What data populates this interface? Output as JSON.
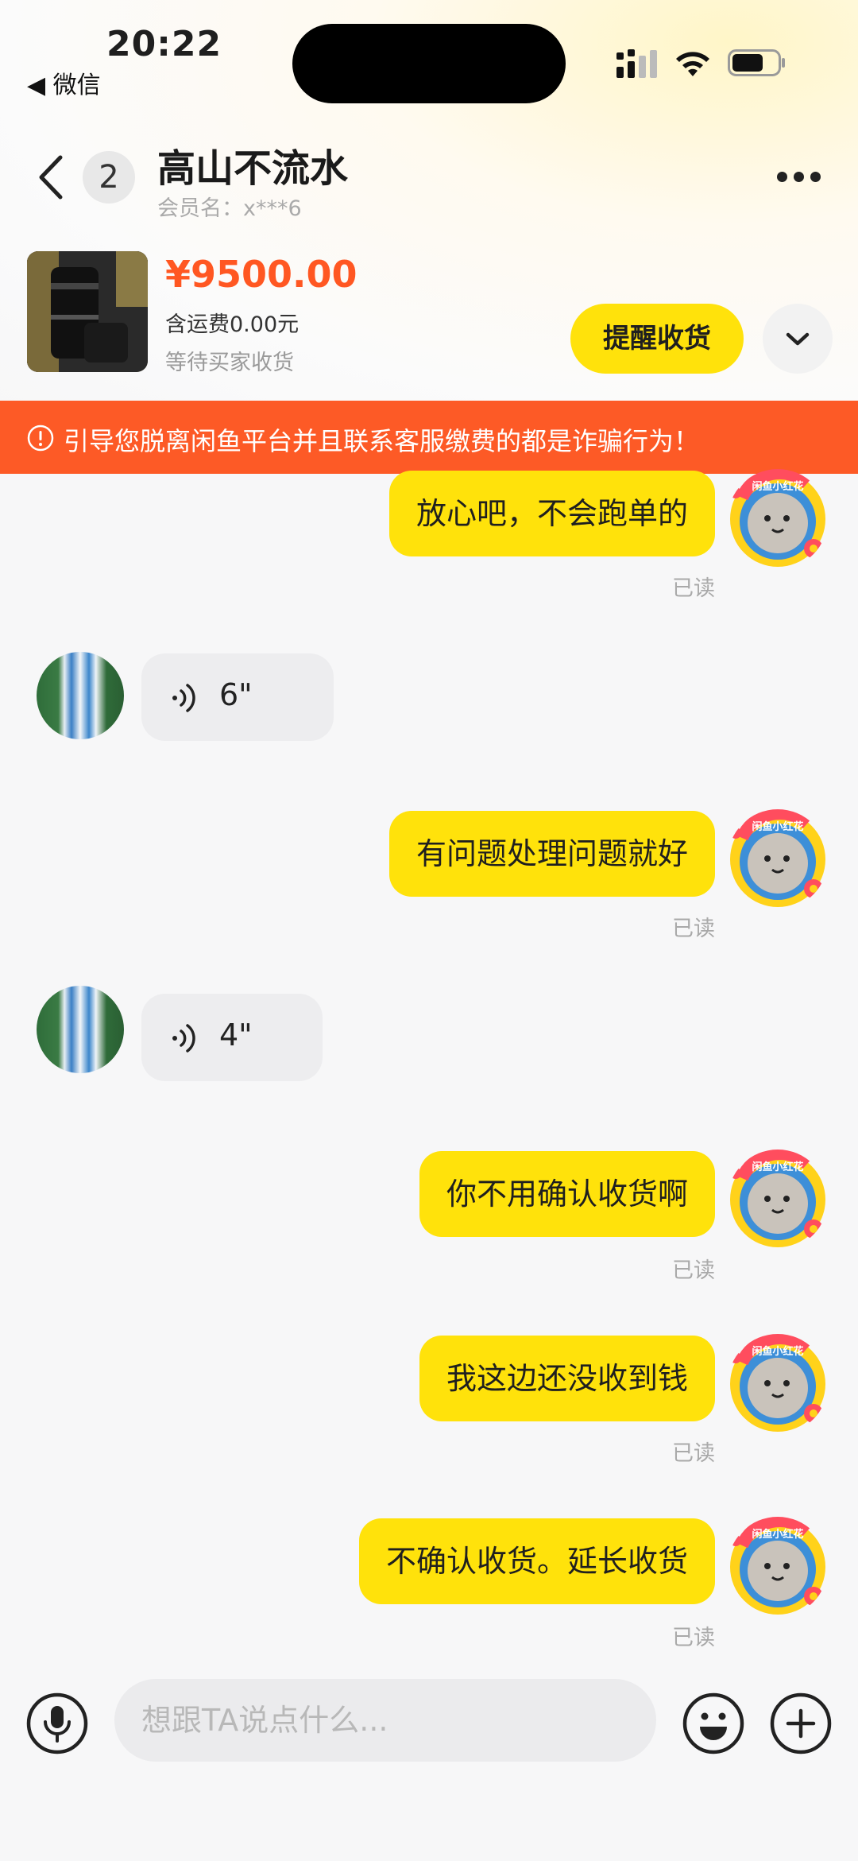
{
  "status_bar": {
    "time": "20:22",
    "back_app": "◀ 微信"
  },
  "header": {
    "unread_count": "2",
    "contact_name": "高山不流水",
    "member_name": "会员名：x***6"
  },
  "order": {
    "price": "¥9500.00",
    "shipping": "含运费0.00元",
    "status": "等待买家收货",
    "remind_button": "提醒收货"
  },
  "warning": {
    "text": "引导您脱离闲鱼平台并且联系客服缴费的都是诈骗行为！"
  },
  "avatar_badge_text": "闲鱼小红花",
  "messages": [
    {
      "type": "text",
      "from": "self",
      "text": "放心吧，不会跑单的",
      "status": "已读"
    },
    {
      "type": "voice",
      "from": "other",
      "duration": "6\""
    },
    {
      "type": "text",
      "from": "self",
      "text": "有问题处理问题就好",
      "status": "已读"
    },
    {
      "type": "voice",
      "from": "other",
      "duration": "4\""
    },
    {
      "type": "text",
      "from": "self",
      "text": "你不用确认收货啊",
      "status": "已读"
    },
    {
      "type": "text",
      "from": "self",
      "text": "我这边还没收到钱",
      "status": "已读"
    },
    {
      "type": "text",
      "from": "self",
      "text": "不确认收货。延长收货",
      "status": "已读"
    }
  ],
  "input": {
    "placeholder": "想跟TA说点什么..."
  },
  "colors": {
    "accent_yellow": "#ffe20b",
    "price_orange": "#ff5722",
    "warning_bg": "#fd5a26"
  },
  "icons": [
    "back-chevron-icon",
    "more-dots-icon",
    "chevron-down-icon",
    "warning-icon",
    "voice-wave-icon",
    "microphone-icon",
    "emoji-icon",
    "plus-icon"
  ]
}
